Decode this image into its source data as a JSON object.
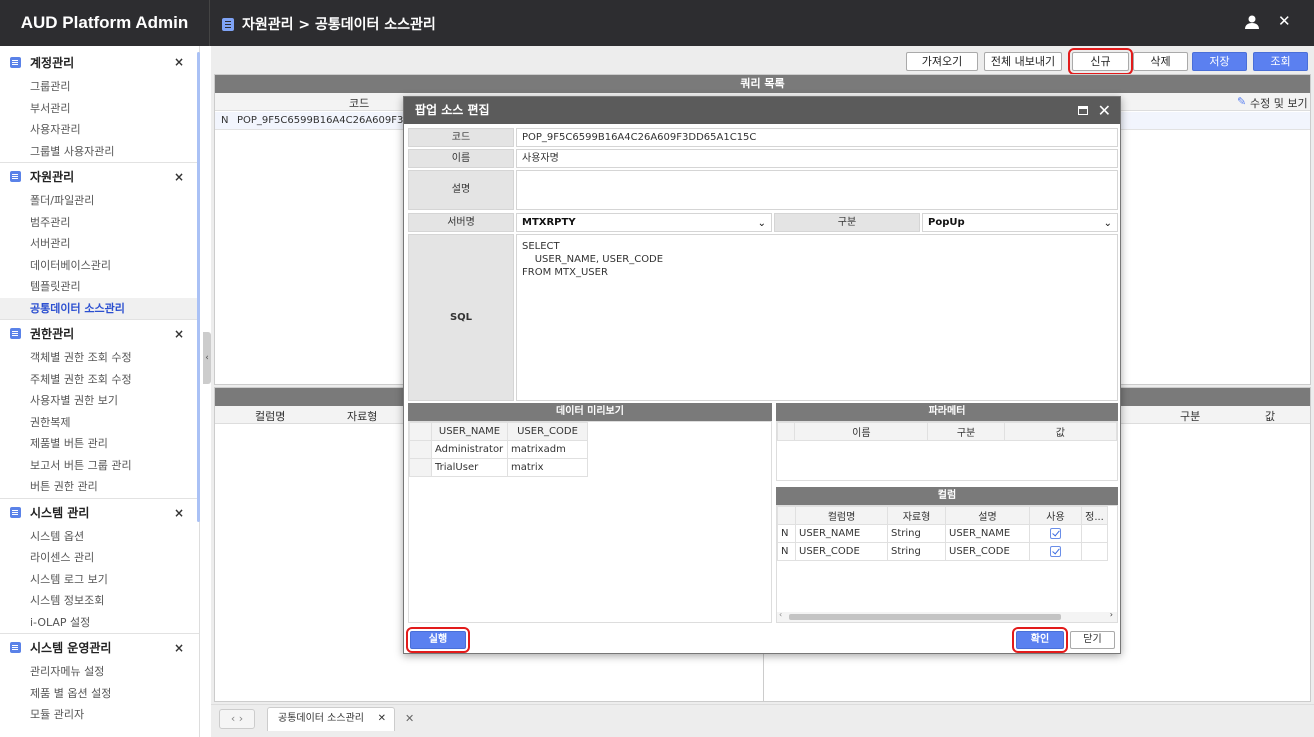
{
  "app": {
    "title": "AUD Platform Admin"
  },
  "header": {
    "breadcrumb": "자원관리 > 공통데이터 소스관리",
    "close_glyph": "✕"
  },
  "sidebar": {
    "groups": [
      {
        "label": "계정관리",
        "close": "×",
        "items": [
          "그룹관리",
          "부서관리",
          "사용자관리",
          "그룹별 사용자관리"
        ]
      },
      {
        "label": "자원관리",
        "close": "×",
        "items": [
          "폴더/파일관리",
          "범주관리",
          "서버관리",
          "데이터베이스관리",
          "템플릿관리",
          "공통데이터 소스관리"
        ]
      },
      {
        "label": "권한관리",
        "close": "×",
        "items": [
          "객체별 권한 조회 수정",
          "주체별 권한 조회 수정",
          "사용자별 권한 보기",
          "권한복제",
          "제품별 버튼 관리",
          "보고서 버튼 그룹 관리",
          "버튼 권한 관리"
        ]
      },
      {
        "label": "시스템 관리",
        "close": "×",
        "items": [
          "시스템 옵션",
          "라이센스 관리",
          "시스템 로그 보기",
          "시스템 정보조회",
          "i-OLAP 설정"
        ]
      },
      {
        "label": "시스템 운영관리",
        "close": "×",
        "items": [
          "관리자메뉴 설정",
          "제품 별 옵션 설정",
          "모듈 관리자"
        ]
      }
    ],
    "active": "공통데이터 소스관리"
  },
  "toolbar": {
    "import": "가져오기",
    "export_all": "전체 내보내기",
    "new": "신규",
    "delete": "삭제",
    "save": "저장",
    "search": "조회"
  },
  "query_list": {
    "title": "쿼리 목록",
    "col_code": "코드",
    "col_modify": "수정 및 보기",
    "row_flag": "N",
    "row_code": "POP_9F5C6599B16A4C26A609F3DD65"
  },
  "bottom_grid": {
    "col_name": "컬럼명",
    "col_type": "자료형",
    "col_kind": "구분",
    "col_value": "값"
  },
  "modal": {
    "title": "팝업 소스 편집",
    "close": "✕",
    "labels": {
      "code": "코드",
      "name": "이름",
      "desc": "설명",
      "server": "서버명",
      "kind": "구분",
      "sql": "SQL"
    },
    "values": {
      "code": "POP_9F5C6599B16A4C26A609F3DD65A1C15C",
      "name": "사용자명",
      "desc": "",
      "server": "MTXRPTY",
      "kind": "PopUp",
      "sql_lines": [
        "SELECT",
        "    USER_NAME, USER_CODE",
        "FROM MTX_USER"
      ]
    },
    "preview": {
      "title": "데이터 미리보기",
      "headers": [
        "USER_NAME",
        "USER_CODE"
      ],
      "rows": [
        [
          "Administrator",
          "matrixadm"
        ],
        [
          "TrialUser",
          "matrix"
        ]
      ]
    },
    "params": {
      "title": "파라메터",
      "headers": [
        "이름",
        "구분",
        "값"
      ]
    },
    "columns": {
      "title": "컬럼",
      "headers": [
        "컬럼명",
        "자료형",
        "설명",
        "사용",
        "정..."
      ],
      "rows": [
        {
          "flag": "N",
          "name": "USER_NAME",
          "type": "String",
          "desc": "USER_NAME",
          "use": true
        },
        {
          "flag": "N",
          "name": "USER_CODE",
          "type": "String",
          "desc": "USER_CODE",
          "use": true
        }
      ]
    },
    "run": "실행",
    "ok": "확인",
    "close_btn": "닫기"
  },
  "tabs": {
    "current": "공통데이터 소스관리",
    "close": "✕"
  }
}
